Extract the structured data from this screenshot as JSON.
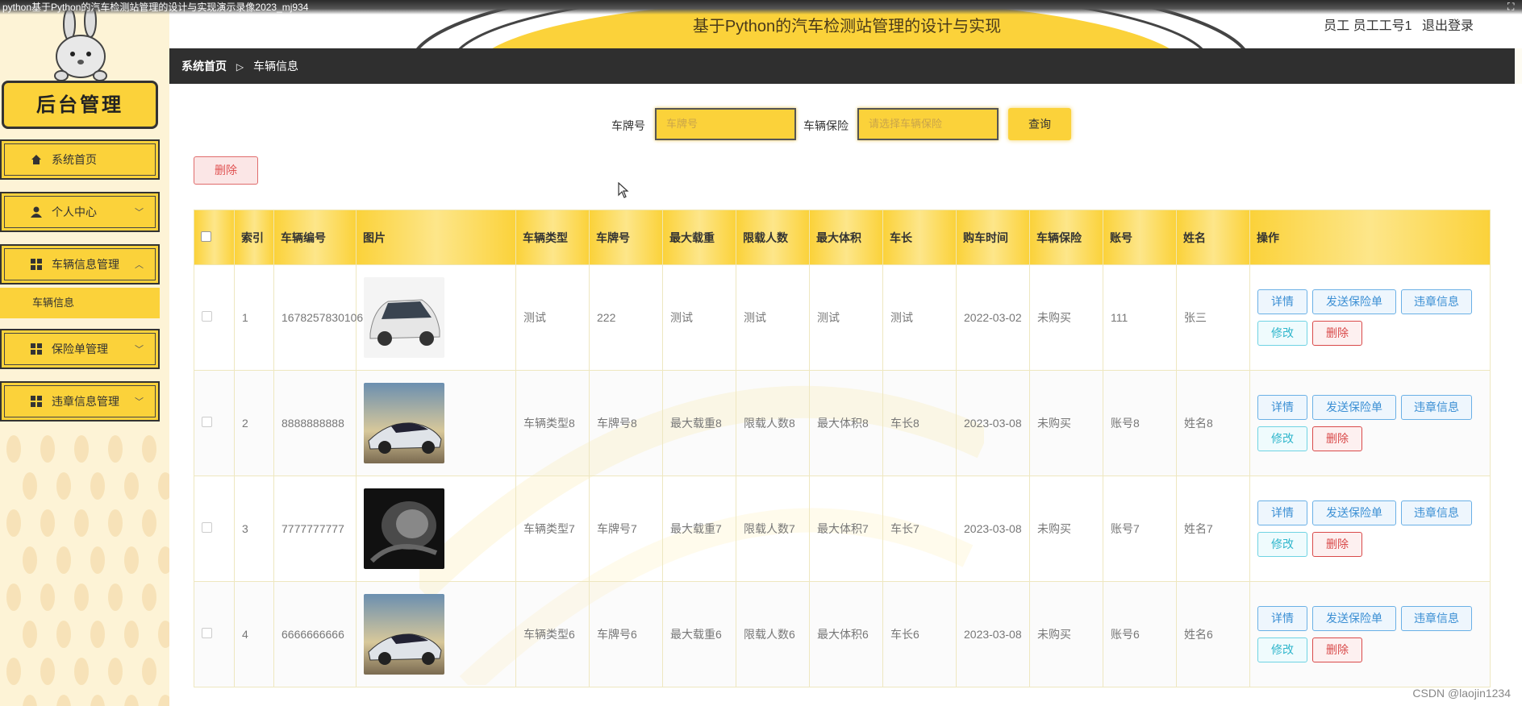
{
  "video_title": "python基于Python的汽车检测站管理的设计与实现演示录像2023_mj934",
  "brand": "后台管理",
  "menu": {
    "home": "系统首页",
    "personal": "个人中心",
    "vehicle_mgmt": "车辆信息管理",
    "vehicle_info": "车辆信息",
    "insurance_mgmt": "保险单管理",
    "violation_mgmt": "违章信息管理"
  },
  "header": {
    "title": "基于Python的汽车检测站管理的设计与实现",
    "user": "员工 员工工号1",
    "logout": "退出登录"
  },
  "breadcrumb": {
    "home": "系统首页",
    "sep": "▷",
    "current": "车辆信息"
  },
  "search": {
    "plate_label": "车牌号",
    "plate_placeholder": "车牌号",
    "insurance_label": "车辆保险",
    "insurance_placeholder": "请选择车辆保险",
    "query": "查询"
  },
  "actions": {
    "delete": "删除"
  },
  "table": {
    "headers": [
      "索引",
      "车辆编号",
      "图片",
      "车辆类型",
      "车牌号",
      "最大载重",
      "限载人数",
      "最大体积",
      "车长",
      "购车时间",
      "车辆保险",
      "账号",
      "姓名",
      "操作"
    ],
    "rows": [
      {
        "index": "1",
        "vehicle_no": "1678257830106",
        "type": "测试",
        "plate": "222",
        "max_load": "测试",
        "limit": "测试",
        "max_volume": "测试",
        "length": "测试",
        "buy_time": "2022-03-02",
        "insurance": "未购买",
        "account": "111",
        "name": "张三"
      },
      {
        "index": "2",
        "vehicle_no": "8888888888",
        "type": "车辆类型8",
        "plate": "车牌号8",
        "max_load": "最大载重8",
        "limit": "限载人数8",
        "max_volume": "最大体积8",
        "length": "车长8",
        "buy_time": "2023-03-08",
        "insurance": "未购买",
        "account": "账号8",
        "name": "姓名8"
      },
      {
        "index": "3",
        "vehicle_no": "7777777777",
        "type": "车辆类型7",
        "plate": "车牌号7",
        "max_load": "最大载重7",
        "limit": "限载人数7",
        "max_volume": "最大体积7",
        "length": "车长7",
        "buy_time": "2023-03-08",
        "insurance": "未购买",
        "account": "账号7",
        "name": "姓名7"
      },
      {
        "index": "4",
        "vehicle_no": "6666666666",
        "type": "车辆类型6",
        "plate": "车牌号6",
        "max_load": "最大载重6",
        "limit": "限载人数6",
        "max_volume": "最大体积6",
        "length": "车长6",
        "buy_time": "2023-03-08",
        "insurance": "未购买",
        "account": "账号6",
        "name": "姓名6"
      }
    ],
    "row_buttons": {
      "detail": "详情",
      "send_insurance": "发送保险单",
      "violation": "违章信息",
      "edit": "修改",
      "delete": "删除"
    }
  },
  "watermark": "CSDN @laojin1234"
}
